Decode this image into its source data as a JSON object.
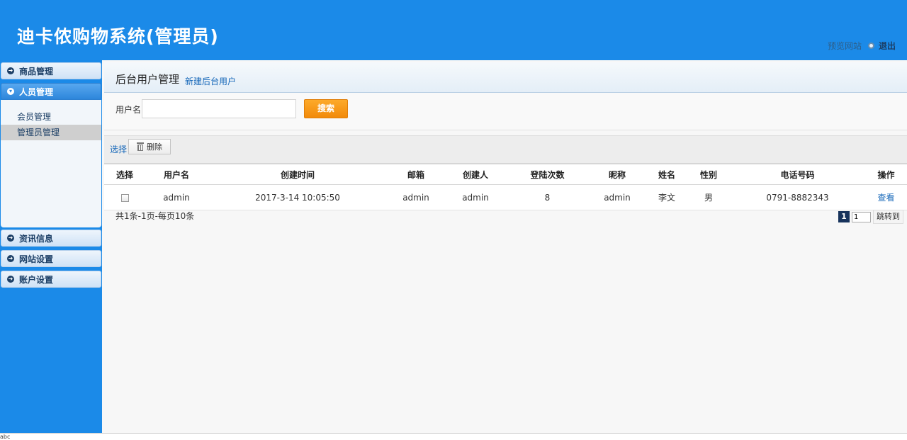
{
  "header": {
    "title": "迪卡侬购物系统(管理员)",
    "preview_label": "预览网站",
    "logout_label": "退出"
  },
  "sidebar": {
    "menus": [
      {
        "label": "商品管理"
      },
      {
        "label": "人员管理"
      },
      {
        "label": "资讯信息"
      },
      {
        "label": "网站设置"
      },
      {
        "label": "账户设置"
      }
    ],
    "submenu": [
      {
        "label": "会员管理"
      },
      {
        "label": "管理员管理"
      }
    ]
  },
  "main": {
    "title": "后台用户管理",
    "new_link": "新建后台用户"
  },
  "search": {
    "label": "用户名",
    "value": "",
    "button": "搜索"
  },
  "toolbar": {
    "select_label": "选择",
    "delete_label": "删除"
  },
  "table": {
    "headers": [
      "选择",
      "用户名",
      "创建时间",
      "邮箱",
      "创建人",
      "登陆次数",
      "昵称",
      "姓名",
      "性别",
      "电话号码",
      "操作"
    ],
    "rows": [
      {
        "username": "admin",
        "created": "2017-3-14 10:05:50",
        "email": "admin",
        "creator": "admin",
        "logins": "8",
        "nickname": "admin",
        "name": "李文",
        "gender": "男",
        "phone": "0791-8882343",
        "action": "查看"
      }
    ]
  },
  "pager": {
    "info": "共1条-1页-每页10条",
    "current": "1",
    "input_value": "1",
    "jump_label": "跳转到"
  },
  "status_bar": {
    "text": "abc"
  },
  "colors": {
    "brand_blue": "#1b8ae8",
    "search_orange": "#f7930f",
    "link_blue": "#1768b9"
  }
}
